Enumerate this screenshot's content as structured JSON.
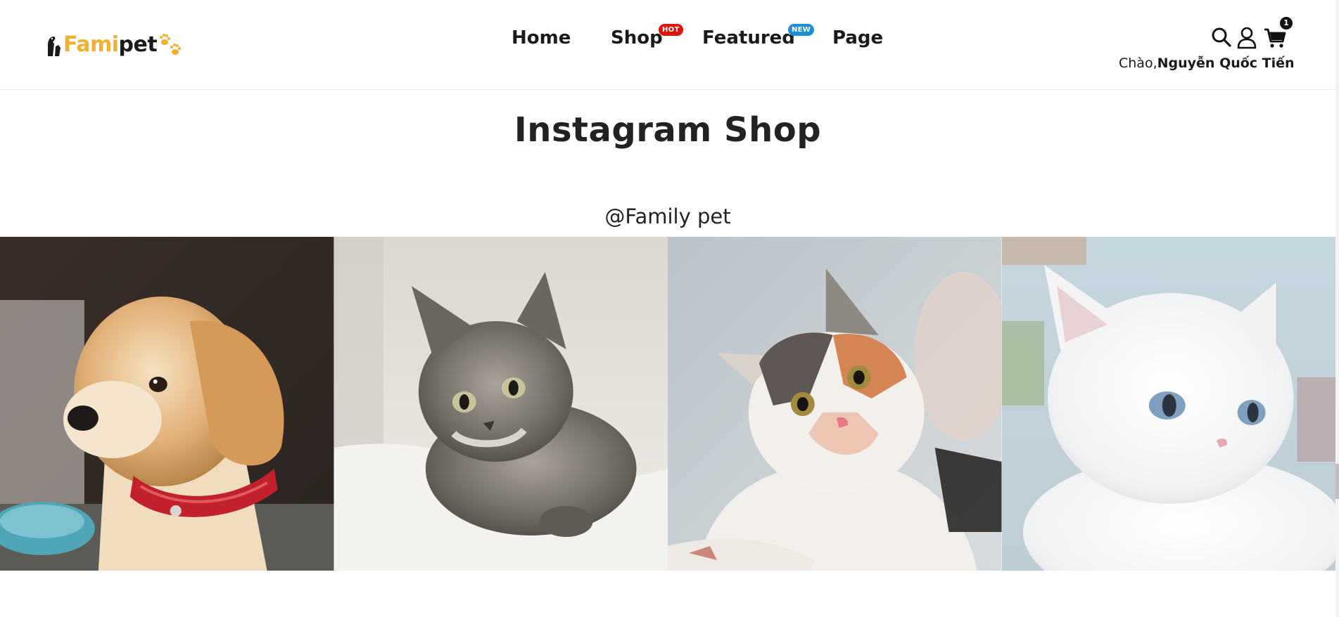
{
  "brand": {
    "logo_part1": "Fami",
    "logo_part2": "pet",
    "accent_color": "#f2b12d"
  },
  "nav": {
    "items": [
      {
        "label": "Home"
      },
      {
        "label": "Shop",
        "badge": "HOT",
        "badge_color": "#e3120b"
      },
      {
        "label": "Featured",
        "badge": "NEW",
        "badge_color": "#1e8fd4"
      },
      {
        "label": "Page"
      }
    ]
  },
  "header_icons": {
    "search": "search-icon",
    "user": "user-icon",
    "cart": "cart-icon",
    "cart_count": "1"
  },
  "greeting": {
    "prefix": "Chào,",
    "name": "Nguyễn Quốc Tiến"
  },
  "instagram": {
    "title": "Instagram Shop",
    "handle": "@Family pet",
    "photos": [
      {
        "subject": "golden retriever puppy with red collar"
      },
      {
        "subject": "grey tabby kitten"
      },
      {
        "subject": "calico kitten looking up"
      },
      {
        "subject": "white kitten with blue eyes"
      }
    ]
  }
}
